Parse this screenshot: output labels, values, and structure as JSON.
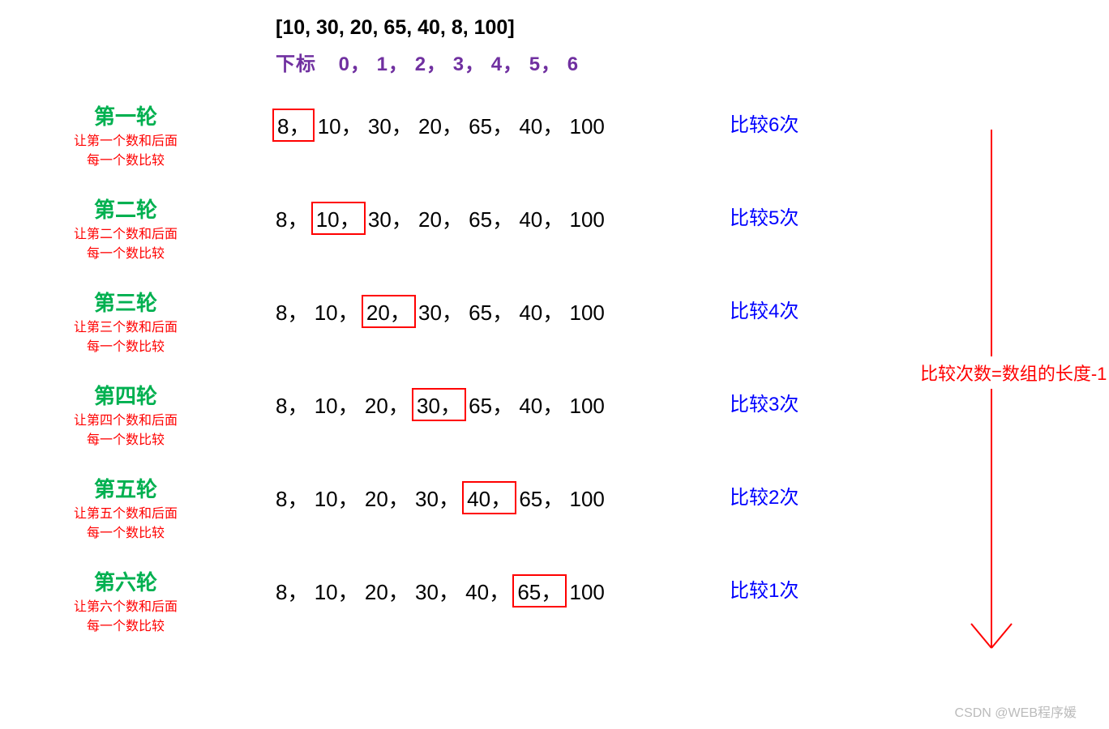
{
  "header": {
    "array_text": "[10, 30, 20, 65, 40, 8, 100]",
    "index_label": "下标",
    "index_values": "0， 1， 2， 3， 4， 5， 6"
  },
  "rounds": [
    {
      "title": "第一轮",
      "desc1": "让第一个数和后面",
      "desc2": "每一个数比较",
      "sequence": [
        "8，",
        "10，",
        "30，",
        "20，",
        "65，",
        "40，",
        "100"
      ],
      "boxed_index": 0,
      "compare": "比较6次"
    },
    {
      "title": "第二轮",
      "desc1": "让第二个数和后面",
      "desc2": "每一个数比较",
      "sequence": [
        "8，",
        "10，",
        "30，",
        "20，",
        "65，",
        "40，",
        "100"
      ],
      "boxed_index": 1,
      "compare": "比较5次"
    },
    {
      "title": "第三轮",
      "desc1": "让第三个数和后面",
      "desc2": "每一个数比较",
      "sequence": [
        "8，",
        "10，",
        "20，",
        "30，",
        "65，",
        "40，",
        "100"
      ],
      "boxed_index": 2,
      "compare": "比较4次"
    },
    {
      "title": "第四轮",
      "desc1": "让第四个数和后面",
      "desc2": "每一个数比较",
      "sequence": [
        "8，",
        "10，",
        "20，",
        "30，",
        "65，",
        "40，",
        "100"
      ],
      "boxed_index": 3,
      "compare": "比较3次"
    },
    {
      "title": "第五轮",
      "desc1": "让第五个数和后面",
      "desc2": "每一个数比较",
      "sequence": [
        "8，",
        "10，",
        "20，",
        "30，",
        "40，",
        "65，",
        "100"
      ],
      "boxed_index": 4,
      "compare": "比较2次"
    },
    {
      "title": "第六轮",
      "desc1": "让第六个数和后面",
      "desc2": "每一个数比较",
      "sequence": [
        "8，",
        "10，",
        "20，",
        "30，",
        "40，",
        "65，",
        "100"
      ],
      "boxed_index": 5,
      "compare": "比较1次"
    }
  ],
  "arrow_label": "比较次数=数组的长度-1",
  "watermark": "CSDN @WEB程序媛",
  "colors": {
    "green": "#00b050",
    "red": "#ff0000",
    "blue": "#0000ff",
    "purple": "#7030a0"
  }
}
